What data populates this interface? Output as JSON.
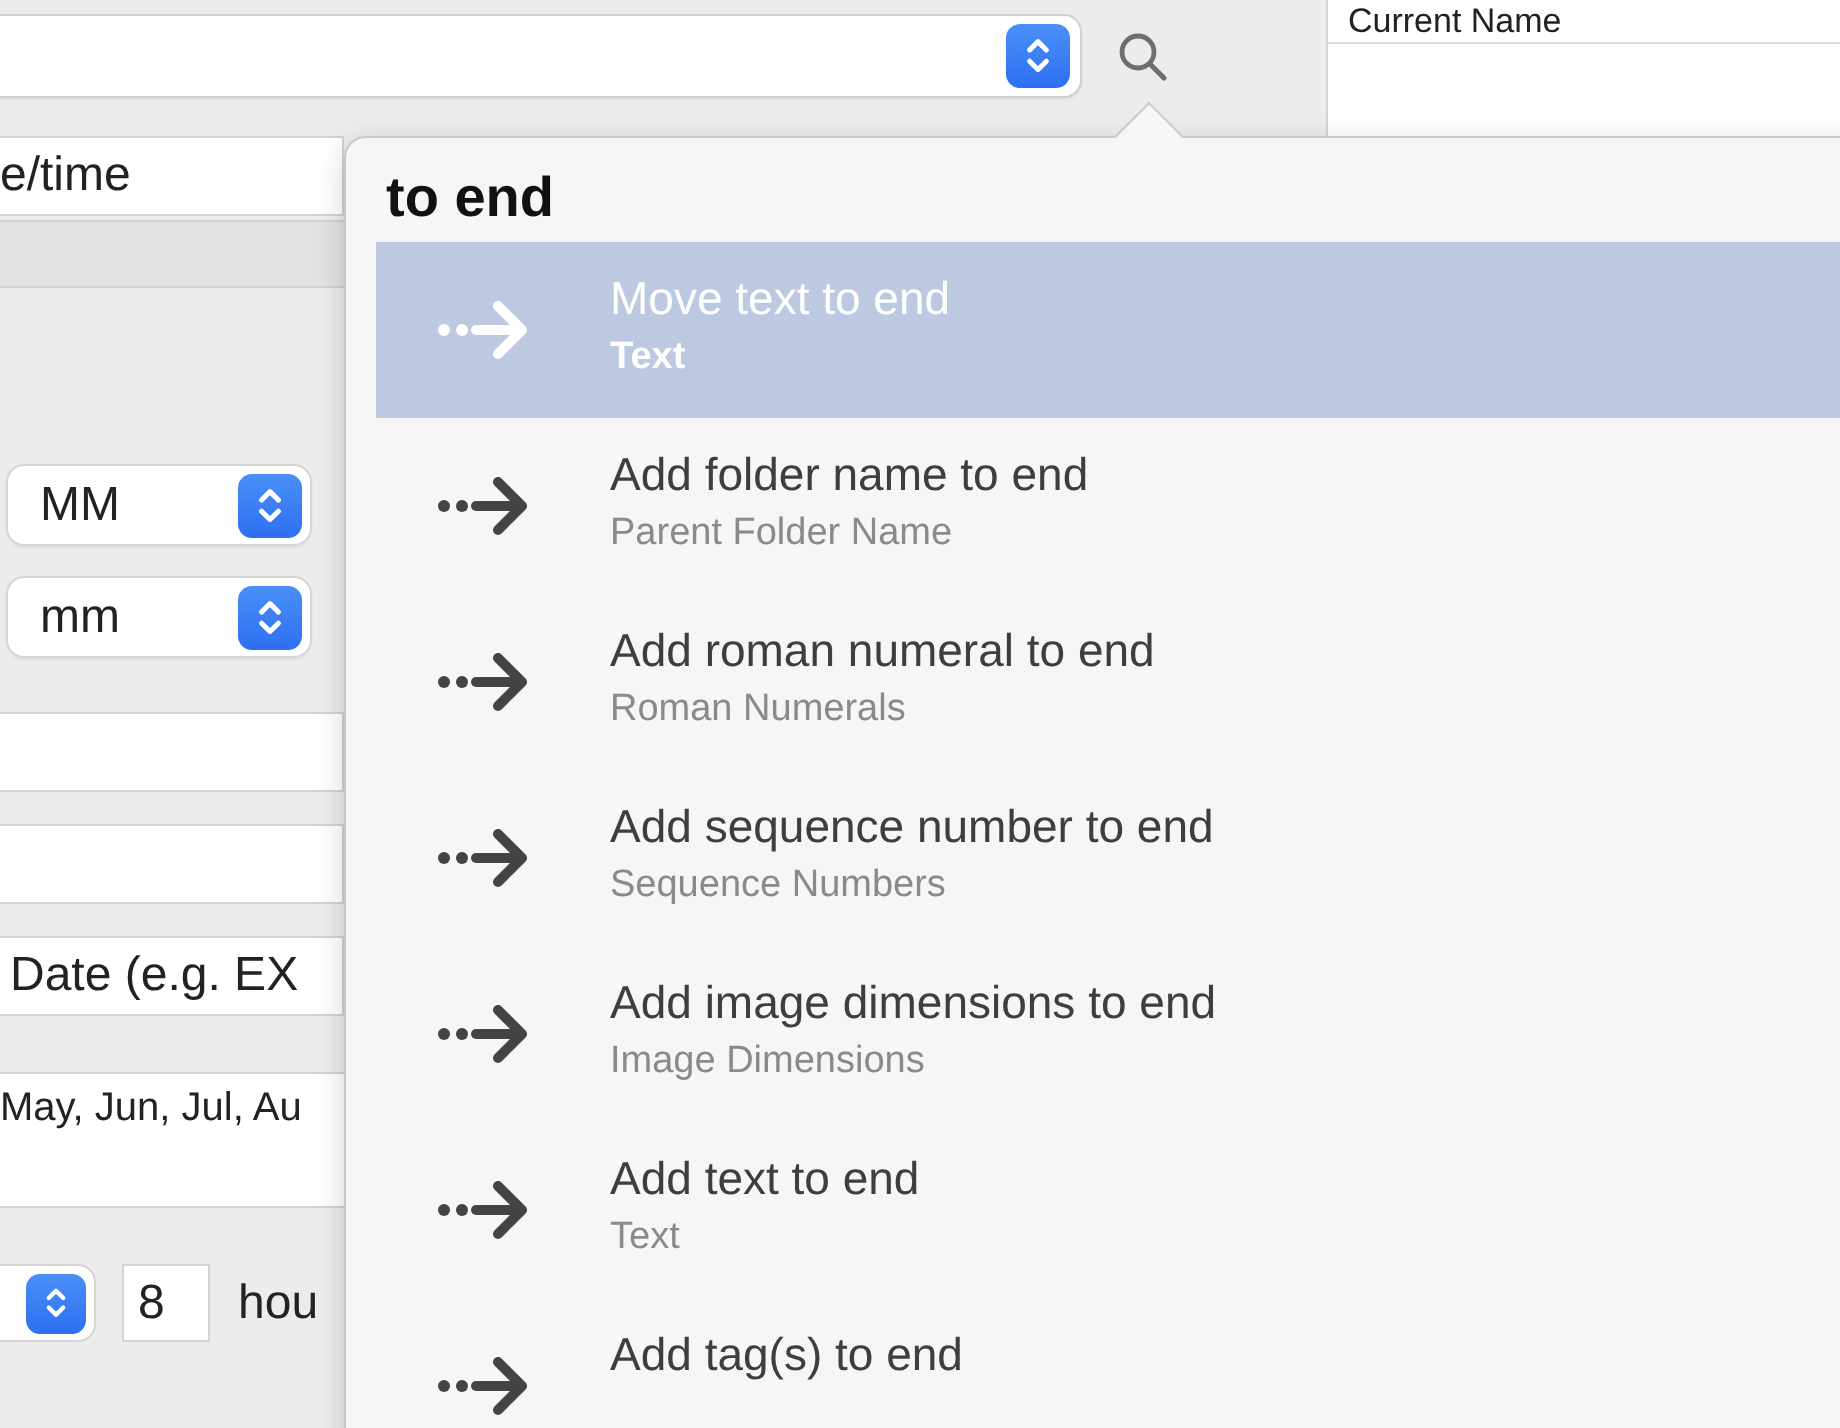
{
  "form": {
    "date_field": "e/time",
    "month_popup": "MM",
    "minute_popup": "mm",
    "source_field": "Date (e.g. EX",
    "months_field": "May, Jun, Jul, Au",
    "hours_value": "8",
    "hours_label": "hou"
  },
  "table": {
    "column_header": "Current Name"
  },
  "popover": {
    "query": "to end",
    "items": [
      {
        "title": "Move text to end",
        "subtitle": "Text",
        "selected": true
      },
      {
        "title": "Add folder name to end",
        "subtitle": "Parent Folder Name",
        "selected": false
      },
      {
        "title": "Add roman numeral to end",
        "subtitle": "Roman Numerals",
        "selected": false
      },
      {
        "title": "Add sequence number to end",
        "subtitle": "Sequence Numbers",
        "selected": false
      },
      {
        "title": "Add image dimensions to end",
        "subtitle": "Image Dimensions",
        "selected": false
      },
      {
        "title": "Add text to end",
        "subtitle": "Text",
        "selected": false
      },
      {
        "title": "Add tag(s) to end",
        "selected": false
      }
    ]
  }
}
